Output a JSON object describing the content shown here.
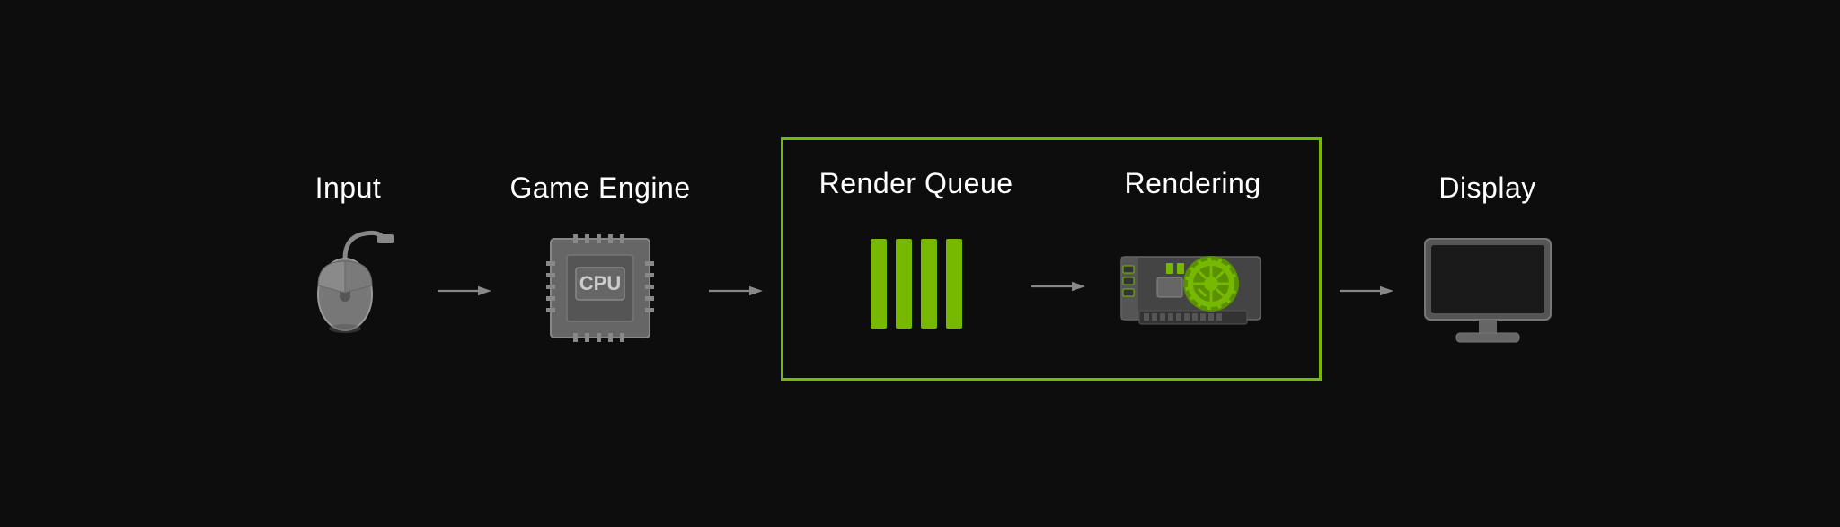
{
  "pipeline": {
    "stages": [
      {
        "id": "input",
        "label": "Input"
      },
      {
        "id": "game-engine",
        "label": "Game Engine"
      },
      {
        "id": "render-queue",
        "label": "Render Queue"
      },
      {
        "id": "rendering",
        "label": "Rendering"
      },
      {
        "id": "display",
        "label": "Display"
      }
    ],
    "arrow_symbol": "→",
    "colors": {
      "green": "#76b900",
      "gray": "#888888",
      "dark_gray": "#666666",
      "background": "#0d0d0d",
      "text": "#ffffff"
    }
  }
}
